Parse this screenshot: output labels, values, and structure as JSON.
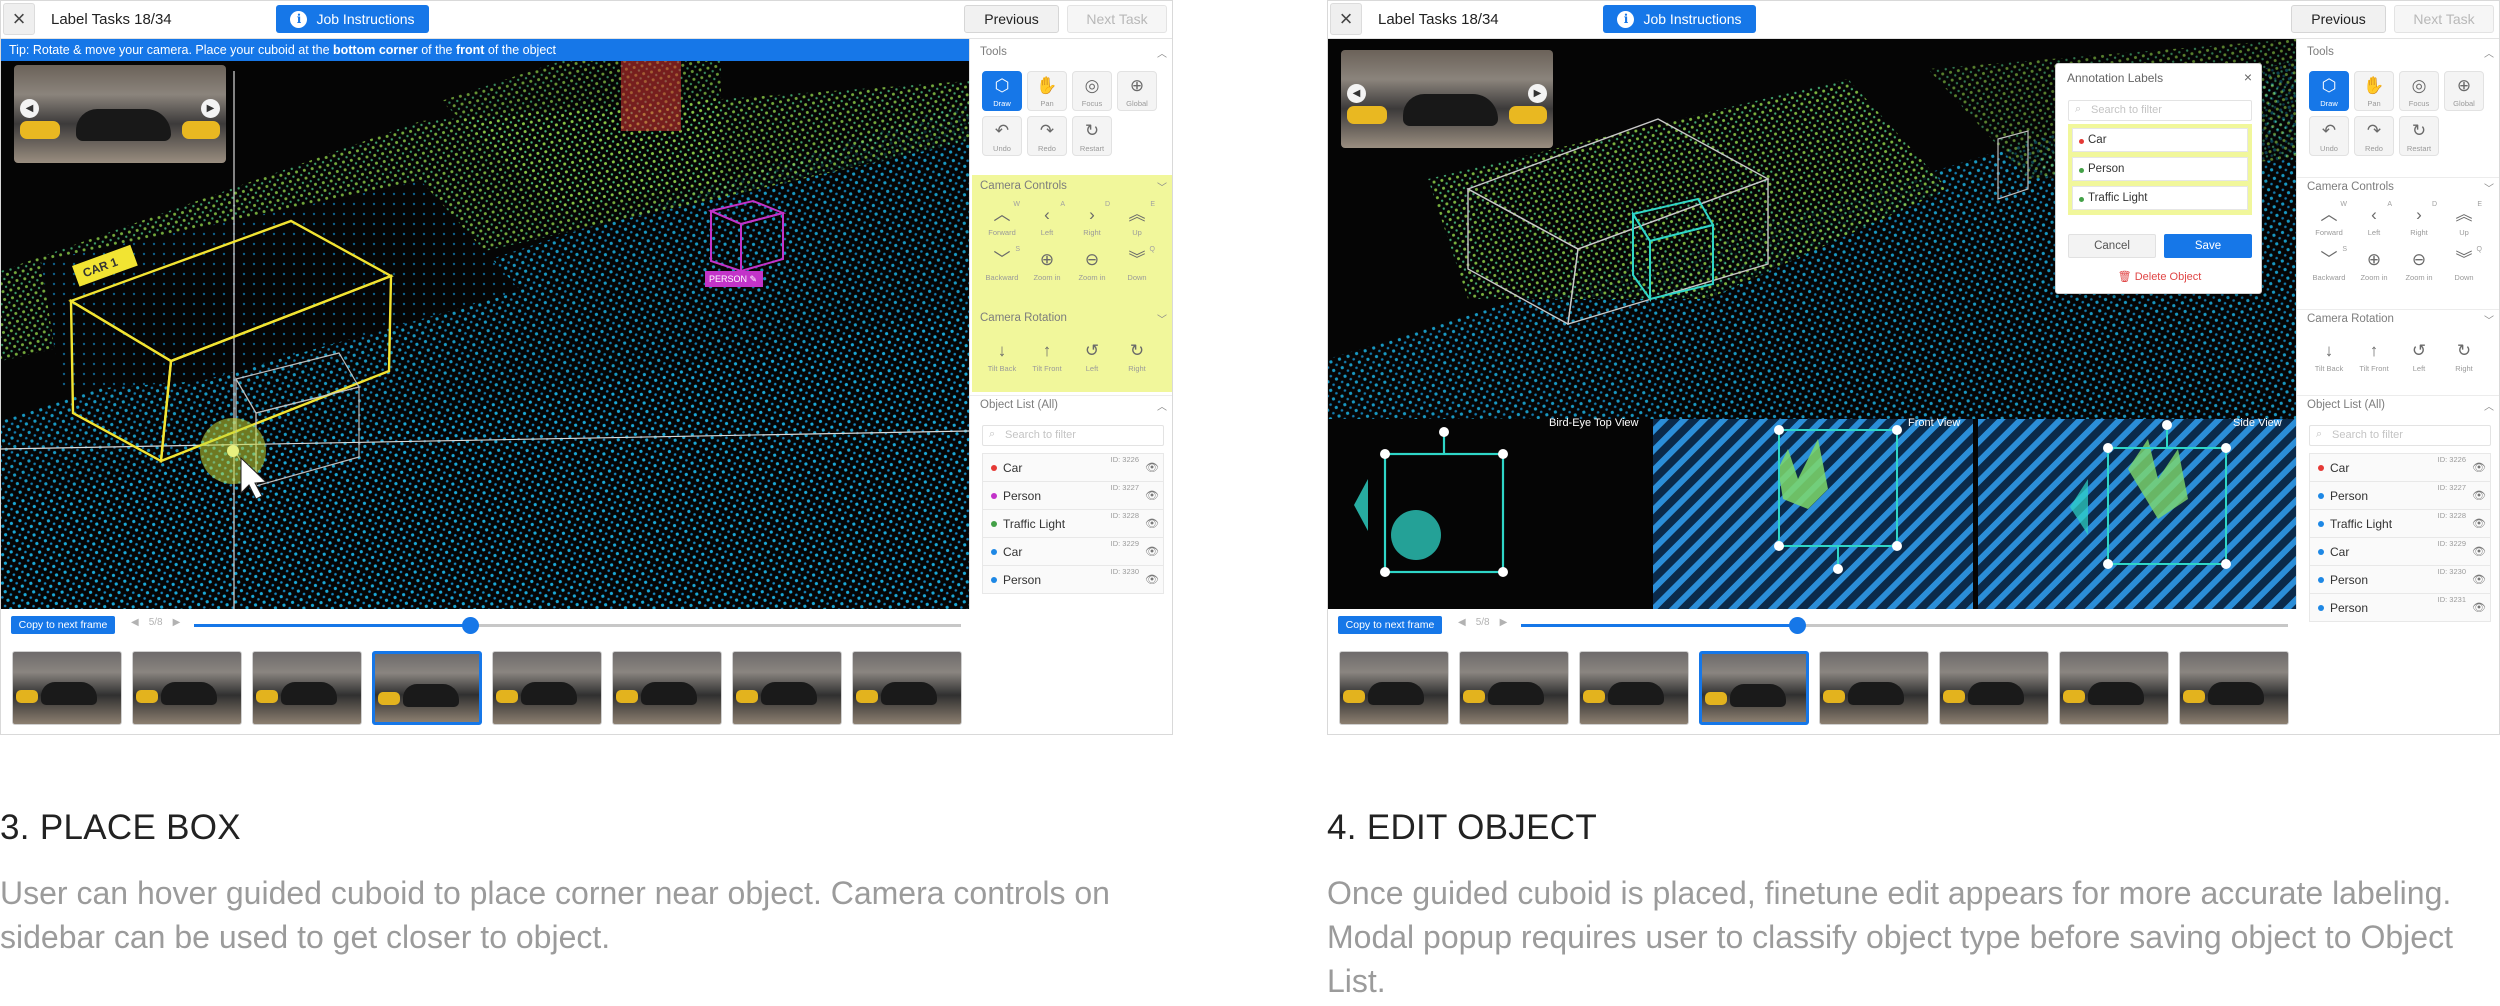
{
  "colors": {
    "accent": "#1677e8",
    "highlight": "#f1f79b",
    "car_box": "#f2e432",
    "person_box": "#c233c9",
    "edit_box": "#2fd6c8"
  },
  "panels": [
    {
      "task_label": "Label Tasks 18/34",
      "job_instructions": "Job Instructions",
      "previous": "Previous",
      "next_task": "Next Task",
      "tip_prefix": "Tip: Rotate & move your camera. Place your cuboid at the ",
      "tip_b1": "bottom corner",
      "tip_mid": " of the ",
      "tip_b2": "front",
      "tip_suffix": " of the object",
      "car_tag": "CAR 1",
      "person_tag": "PERSON",
      "copy_next": "Copy to next frame",
      "frame_counter": "5/8",
      "slider_progress": 0.36,
      "caption_title": "3. PLACE BOX",
      "caption_body": "User can hover guided cuboid to place corner near object. Camera controls on sidebar can be used to get closer to object."
    },
    {
      "task_label": "Label Tasks 18/34",
      "job_instructions": "Job Instructions",
      "previous": "Previous",
      "next_task": "Next Task",
      "birdeye": "Bird-Eye Top View",
      "front_view": "Front View",
      "side_view": "Side View",
      "copy_next": "Copy to next frame",
      "frame_counter": "5/8",
      "slider_progress": 0.36,
      "caption_title": "4. EDIT OBJECT",
      "caption_body": "Once guided cuboid is placed, finetune edit appears for more accurate labeling. Modal popup requires user to classify object type before saving object to Object List."
    }
  ],
  "sidebar": {
    "tools_title": "Tools",
    "tools": [
      {
        "label": "Draw",
        "icon": "cube-icon"
      },
      {
        "label": "Pan",
        "icon": "hand-icon"
      },
      {
        "label": "Focus",
        "icon": "target-icon"
      },
      {
        "label": "Global",
        "icon": "globe-icon"
      },
      {
        "label": "Undo",
        "icon": "undo-icon"
      },
      {
        "label": "Redo",
        "icon": "redo-icon"
      },
      {
        "label": "Restart",
        "icon": "restart-icon"
      }
    ],
    "camera_controls_title": "Camera Controls",
    "camera_controls": [
      {
        "label": "Forward",
        "key": "W",
        "icon": "chevron-up-icon"
      },
      {
        "label": "Left",
        "key": "A",
        "icon": "chevron-left-icon"
      },
      {
        "label": "Right",
        "key": "D",
        "icon": "chevron-right-icon"
      },
      {
        "label": "Up",
        "key": "E",
        "icon": "double-chevron-up-icon"
      },
      {
        "label": "Backward",
        "key": "S",
        "icon": "chevron-down-icon"
      },
      {
        "label": "Zoom in",
        "key": "",
        "icon": "zoom-in-icon"
      },
      {
        "label": "Zoom in",
        "key": "",
        "icon": "zoom-out-icon"
      },
      {
        "label": "Down",
        "key": "Q",
        "icon": "double-chevron-down-icon"
      }
    ],
    "camera_rotation_title": "Camera Rotation",
    "camera_rotation": [
      {
        "label": "Tilt Back",
        "icon": "arrow-down-icon"
      },
      {
        "label": "Tilt Front",
        "icon": "arrow-up-icon"
      },
      {
        "label": "Left",
        "icon": "rotate-left-icon"
      },
      {
        "label": "Right",
        "icon": "rotate-right-icon"
      }
    ],
    "object_list_title": "Object List (All)",
    "filter_placeholder": "Search to filter"
  },
  "objects_a": [
    {
      "name": "Car",
      "id": "ID: 3226",
      "color": "#e53935"
    },
    {
      "name": "Person",
      "id": "ID: 3227",
      "color": "#c233c9"
    },
    {
      "name": "Traffic Light",
      "id": "ID: 3228",
      "color": "#43a047"
    },
    {
      "name": "Car",
      "id": "ID: 3229",
      "color": "#1e88e5"
    },
    {
      "name": "Person",
      "id": "ID: 3230",
      "color": "#1e88e5"
    }
  ],
  "objects_b": [
    {
      "name": "Car",
      "id": "ID: 3226",
      "color": "#e53935"
    },
    {
      "name": "Person",
      "id": "ID: 3227",
      "color": "#1e88e5"
    },
    {
      "name": "Traffic Light",
      "id": "ID: 3228",
      "color": "#1e88e5"
    },
    {
      "name": "Car",
      "id": "ID: 3229",
      "color": "#1e88e5"
    },
    {
      "name": "Person",
      "id": "ID: 3230",
      "color": "#1e88e5"
    },
    {
      "name": "Person",
      "id": "ID: 3231",
      "color": "#1e88e5"
    }
  ],
  "modal": {
    "title": "Annotation Labels",
    "filter_placeholder": "Search to filter",
    "options": [
      {
        "label": "Car",
        "color": "#e53935"
      },
      {
        "label": "Person",
        "color": "#43a047"
      },
      {
        "label": "Traffic Light",
        "color": "#43a047"
      }
    ],
    "cancel": "Cancel",
    "save": "Save",
    "delete": "Delete Object"
  }
}
